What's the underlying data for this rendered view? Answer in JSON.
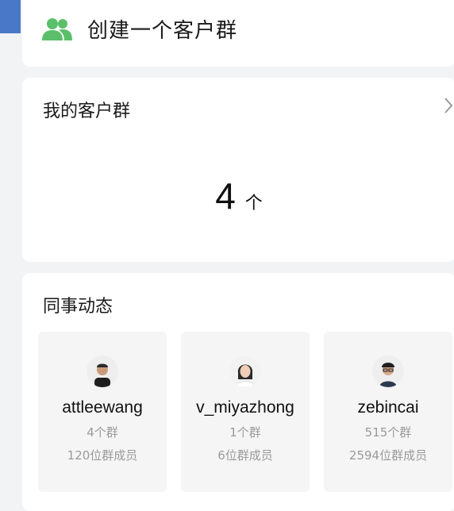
{
  "create": {
    "label": "创建一个客户群",
    "icon": "users-icon",
    "icon_color": "#5bbf6a"
  },
  "my_groups": {
    "title": "我的客户群",
    "count": "4",
    "unit": "个"
  },
  "colleagues": {
    "title": "同事动态",
    "items": [
      {
        "name": "attleewang",
        "groups": "4个群",
        "members": "120位群成员"
      },
      {
        "name": "v_miyazhong",
        "groups": "1个群",
        "members": "6位群成员"
      },
      {
        "name": "zebincai",
        "groups": "515个群",
        "members": "2594位群成员"
      }
    ]
  },
  "colors": {
    "accent": "#4a78c9",
    "background": "#f2f3f5",
    "muted_text": "#9a9a9a"
  }
}
